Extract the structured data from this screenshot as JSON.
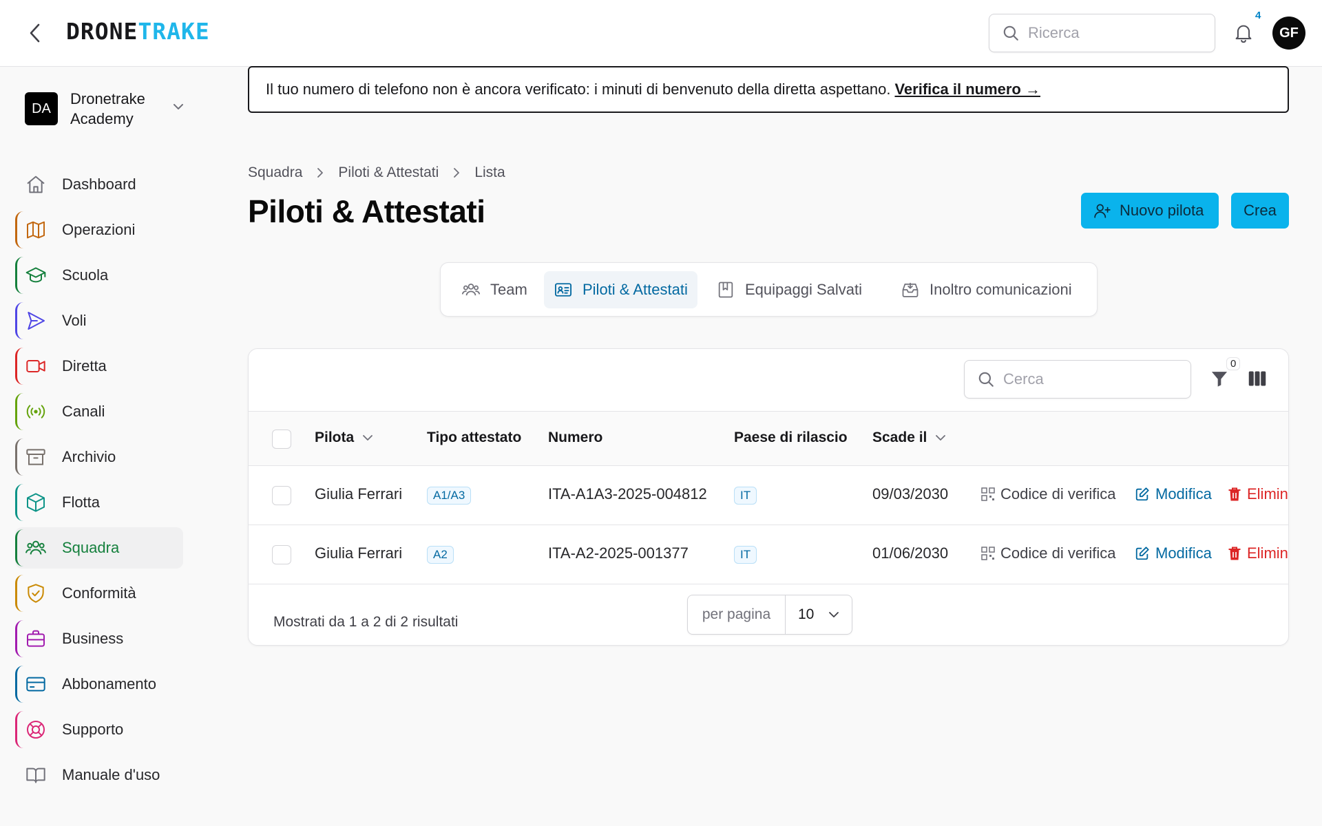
{
  "header": {
    "logo_part1": "DRONE",
    "logo_part2": "TRAKE",
    "search_placeholder": "Ricerca",
    "notification_count": "4",
    "avatar_initials": "GF"
  },
  "org": {
    "initials": "DA",
    "name": "Dronetrake Academy"
  },
  "sidebar": {
    "items": [
      {
        "label": "Dashboard",
        "icon": "home-icon",
        "color": "#71717a"
      },
      {
        "label": "Operazioni",
        "icon": "map-icon",
        "color": "#c2670f"
      },
      {
        "label": "Scuola",
        "icon": "graduation-cap-icon",
        "color": "#15803d"
      },
      {
        "label": "Voli",
        "icon": "send-icon",
        "color": "#4f46e5"
      },
      {
        "label": "Diretta",
        "icon": "video-icon",
        "color": "#dc2626"
      },
      {
        "label": "Canali",
        "icon": "radio-icon",
        "color": "#65a30d"
      },
      {
        "label": "Archivio",
        "icon": "archive-icon",
        "color": "#78716c"
      },
      {
        "label": "Flotta",
        "icon": "box-icon",
        "color": "#0d9488"
      },
      {
        "label": "Squadra",
        "icon": "users-icon",
        "color": "#15803d"
      },
      {
        "label": "Conformità",
        "icon": "shield-check-icon",
        "color": "#ca8a04"
      },
      {
        "label": "Business",
        "icon": "briefcase-icon",
        "color": "#a21caf"
      },
      {
        "label": "Abbonamento",
        "icon": "credit-card-icon",
        "color": "#0369a1"
      },
      {
        "label": "Supporto",
        "icon": "life-buoy-icon",
        "color": "#db2777"
      },
      {
        "label": "Manuale d'uso",
        "icon": "book-open-icon",
        "color": "#71717a"
      }
    ],
    "active": "Squadra"
  },
  "banner": {
    "text": "Il tuo numero di telefono non è ancora verificato: i minuti di benvenuto della diretta aspettano.",
    "link": "Verifica il numero →"
  },
  "breadcrumb": [
    "Squadra",
    "Piloti & Attestati",
    "Lista"
  ],
  "page_title": "Piloti & Attestati",
  "buttons": {
    "new_pilot": "Nuovo pilota",
    "create": "Crea"
  },
  "tabs": [
    {
      "label": "Team",
      "icon": "users-icon"
    },
    {
      "label": "Piloti & Attestati",
      "icon": "id-card-icon"
    },
    {
      "label": "Equipaggi Salvati",
      "icon": "bookmark-icon"
    },
    {
      "label": "Inoltro comunicazioni",
      "icon": "inbox-icon"
    }
  ],
  "active_tab": "Piloti & Attestati",
  "table": {
    "search_placeholder": "Cerca",
    "filter_count": "0",
    "columns": [
      "Pilota",
      "Tipo attestato",
      "Numero",
      "Paese di rilascio",
      "Scade il"
    ],
    "rows": [
      {
        "pilot": "Giulia Ferrari",
        "type": "A1/A3",
        "number": "ITA-A1A3-2025-004812",
        "country": "IT",
        "expires": "09/03/2030"
      },
      {
        "pilot": "Giulia Ferrari",
        "type": "A2",
        "number": "ITA-A2-2025-001377",
        "country": "IT",
        "expires": "01/06/2030"
      }
    ],
    "actions": {
      "verify": "Codice di verifica",
      "edit": "Modifica",
      "delete": "Elimina"
    },
    "footer_text": "Mostrati da 1 a 2 di 2 risultati",
    "per_page_label": "per pagina",
    "per_page_value": "10"
  }
}
